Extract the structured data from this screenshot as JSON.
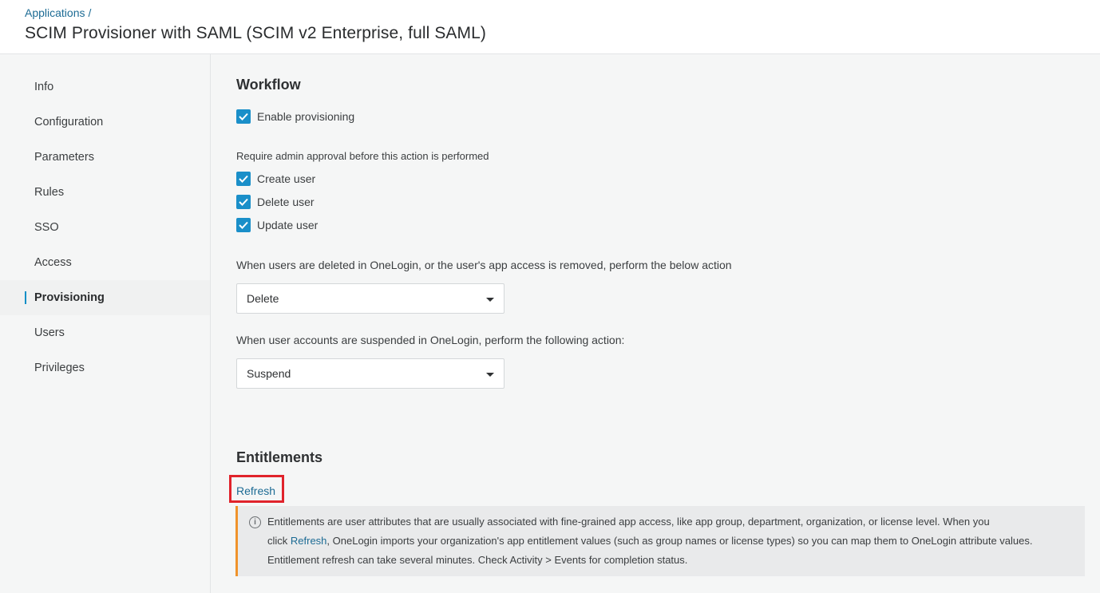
{
  "header": {
    "breadcrumb": "Applications",
    "breadcrumb_sep": "/",
    "title": "SCIM Provisioner with SAML (SCIM v2 Enterprise, full SAML)"
  },
  "sidebar": {
    "items": [
      {
        "label": "Info"
      },
      {
        "label": "Configuration"
      },
      {
        "label": "Parameters"
      },
      {
        "label": "Rules"
      },
      {
        "label": "SSO"
      },
      {
        "label": "Access"
      },
      {
        "label": "Provisioning"
      },
      {
        "label": "Users"
      },
      {
        "label": "Privileges"
      }
    ],
    "active": "Provisioning"
  },
  "workflow": {
    "title": "Workflow",
    "enable_provisioning": {
      "label": "Enable provisioning",
      "checked": true
    },
    "approval_label": "Require admin approval before this action is performed",
    "create_user": {
      "label": "Create user",
      "checked": true
    },
    "delete_user": {
      "label": "Delete user",
      "checked": true
    },
    "update_user": {
      "label": "Update user",
      "checked": true
    },
    "deleted_label": "When users are deleted in OneLogin, or the user's app access is removed, perform the below action",
    "deleted_value": "Delete",
    "suspended_label": "When user accounts are suspended in OneLogin, perform the following action:",
    "suspended_value": "Suspend"
  },
  "entitlements": {
    "title": "Entitlements",
    "refresh_label": "Refresh",
    "info": {
      "line1": "Entitlements are user attributes that are usually associated with fine-grained app access, like app group, department, organization, or license level. When you",
      "line2_pre": "click ",
      "line2_link": "Refresh",
      "line2_post": ", OneLogin imports your organization's app entitlement values (such as group names or license types) so you can map them to OneLogin attribute values.",
      "line3": "Entitlement refresh can take several minutes. Check Activity > Events for completion status."
    }
  },
  "colors": {
    "accent": "#1a8fc9",
    "link": "#1c6b94",
    "highlight": "#e0232b",
    "info_border": "#f0932b"
  }
}
